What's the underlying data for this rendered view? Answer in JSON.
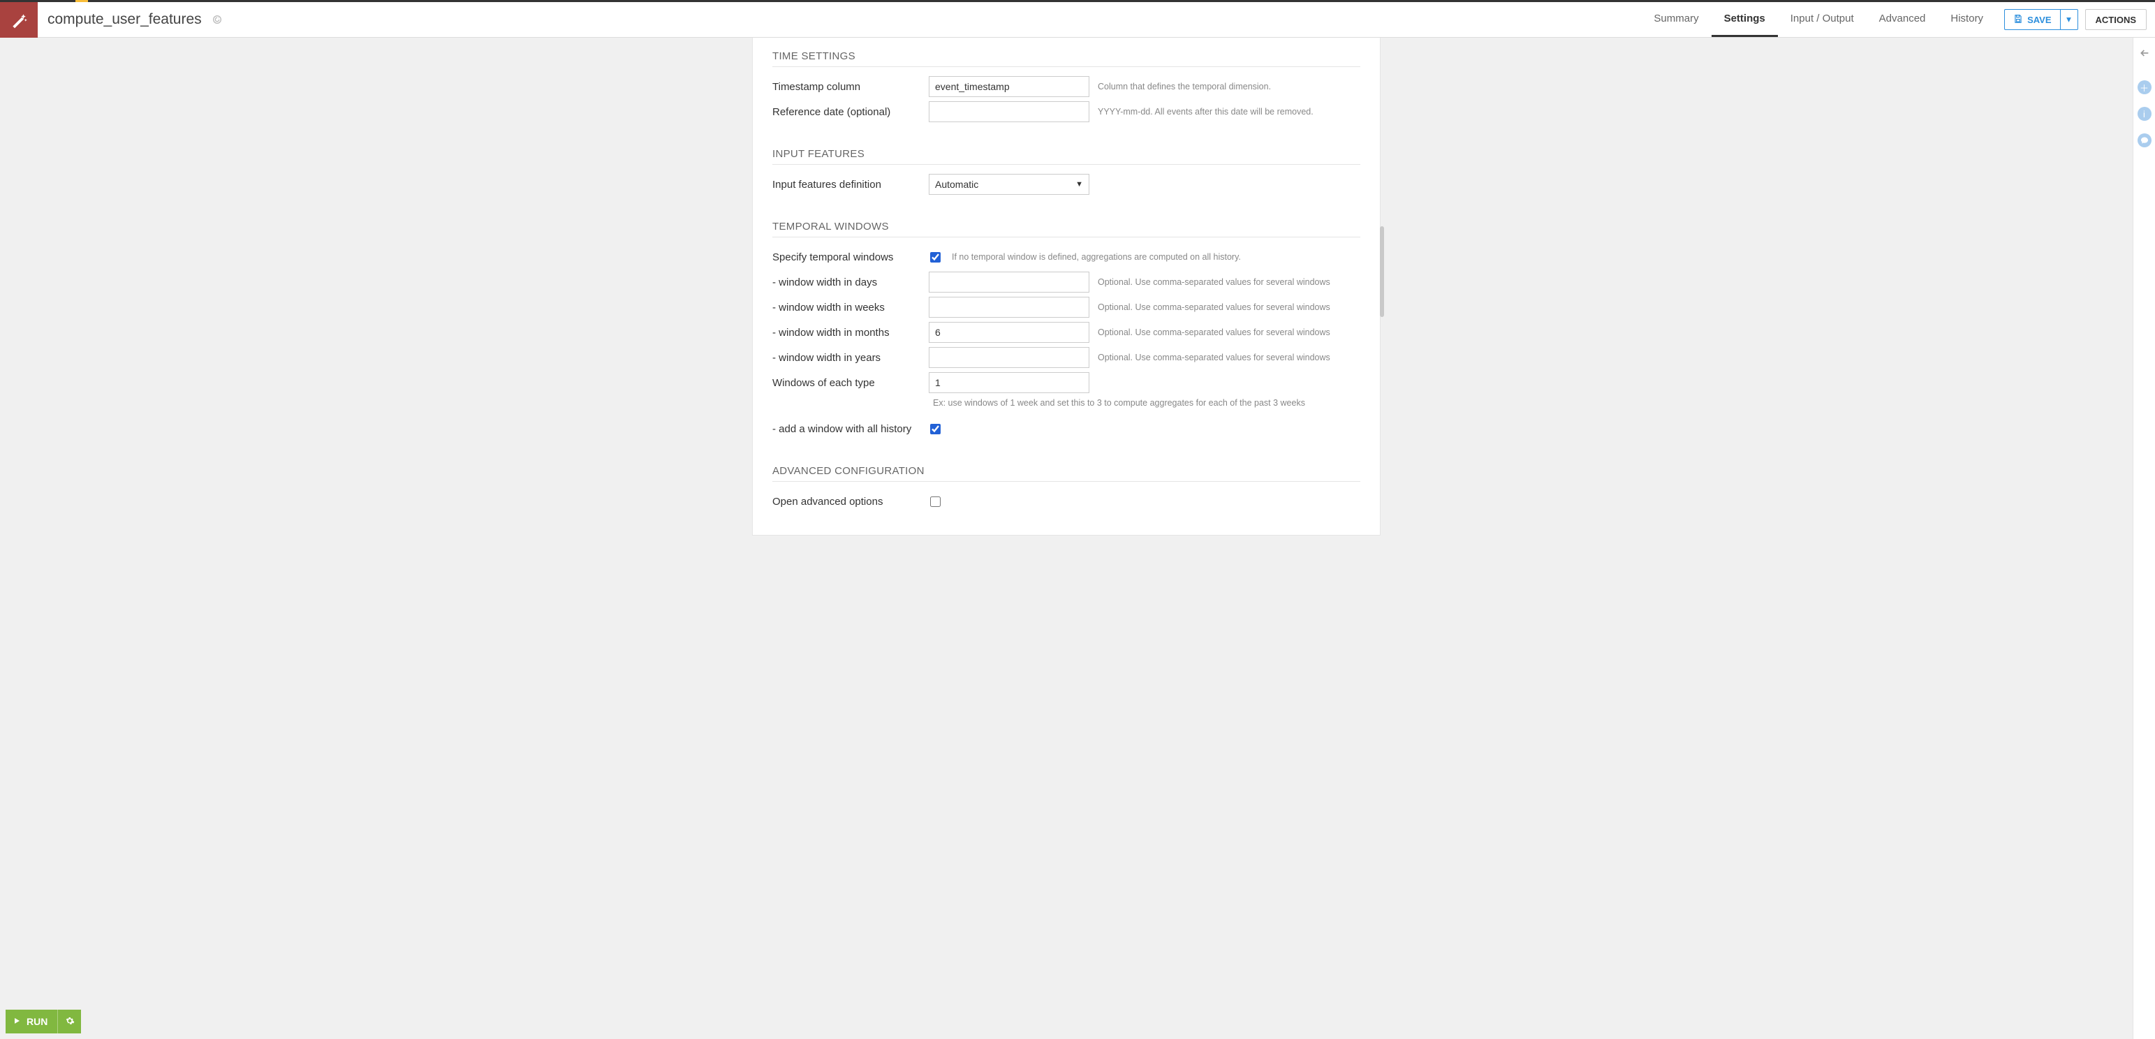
{
  "header": {
    "title": "compute_user_features",
    "tabs": [
      "Summary",
      "Settings",
      "Input / Output",
      "Advanced",
      "History"
    ],
    "active_tab": "Settings",
    "save_label": "SAVE",
    "actions_label": "ACTIONS"
  },
  "sections": {
    "time_settings": {
      "title": "TIME SETTINGS",
      "timestamp_label": "Timestamp column",
      "timestamp_value": "event_timestamp",
      "timestamp_help": "Column that defines the temporal dimension.",
      "refdate_label": "Reference date (optional)",
      "refdate_value": "",
      "refdate_help": "YYYY-mm-dd. All events after this date will be removed."
    },
    "input_features": {
      "title": "INPUT FEATURES",
      "def_label": "Input features definition",
      "def_value": "Automatic"
    },
    "temporal_windows": {
      "title": "TEMPORAL WINDOWS",
      "specify_label": "Specify temporal windows",
      "specify_checked": true,
      "specify_help": "If no temporal window is defined, aggregations are computed on all history.",
      "days_label": "- window width in days",
      "days_value": "",
      "weeks_label": "- window width in weeks",
      "weeks_value": "",
      "months_label": "- window width in months",
      "months_value": "6",
      "years_label": "- window width in years",
      "years_value": "",
      "optional_help": "Optional. Use comma-separated values for several windows",
      "each_label": "Windows of each type",
      "each_value": "1",
      "each_help": "Ex: use windows of 1 week and set this to 3 to compute aggregates for each of the past 3 weeks",
      "all_history_label": "- add a window with all history",
      "all_history_checked": true
    },
    "advanced_config": {
      "title": "ADVANCED CONFIGURATION",
      "open_label": "Open advanced options",
      "open_checked": false
    }
  },
  "run": {
    "label": "RUN"
  }
}
